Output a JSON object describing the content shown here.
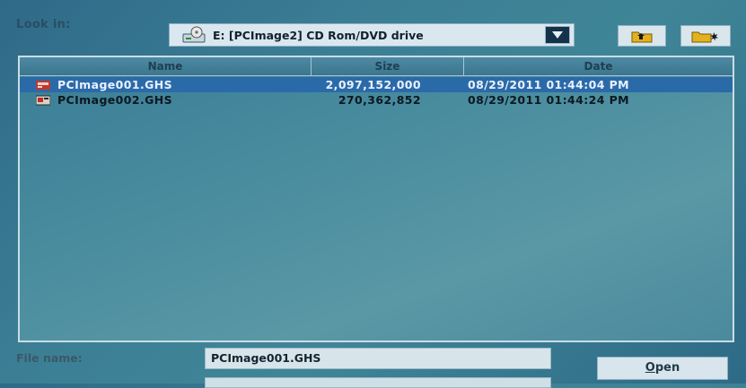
{
  "lookin": {
    "label": "Look in:",
    "drive_text": "E: [PCImage2] CD Rom/DVD drive"
  },
  "toolbar": {
    "icons": [
      "up-folder-icon",
      "new-folder-icon"
    ]
  },
  "file_list": {
    "columns": [
      "Name",
      "Size",
      "Date"
    ],
    "rows": [
      {
        "name": "PCImage001.GHS",
        "size": "2,097,152,000",
        "date": "08/29/2011 01:44:04 PM",
        "selected": true
      },
      {
        "name": "PCImage002.GHS",
        "size": "270,362,852",
        "date": "08/29/2011 01:44:24 PM",
        "selected": false
      }
    ]
  },
  "filename": {
    "label": "File name:",
    "value": "PCImage001.GHS"
  },
  "buttons": {
    "open_first": "O",
    "open_rest": "pen"
  },
  "colors": {
    "selection": "#2b6aa8",
    "background": "#3c7f95"
  }
}
